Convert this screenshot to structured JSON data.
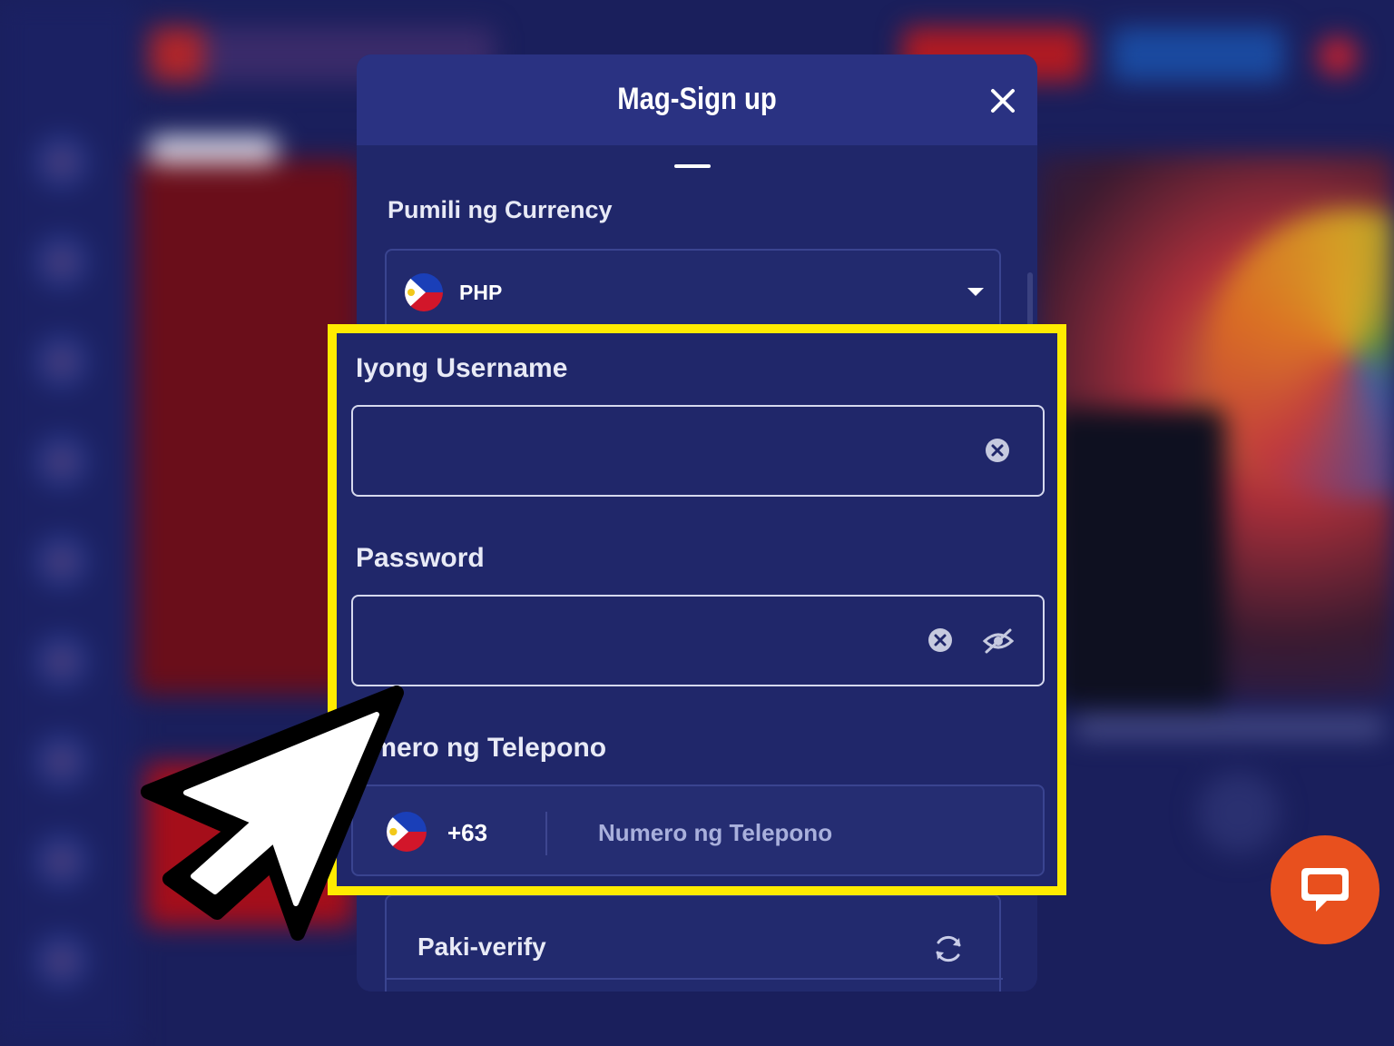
{
  "modal": {
    "title": "Mag-Sign up",
    "currency_label": "Pumili ng Currency",
    "currency_value": "PHP",
    "username_label": "Iyong Username",
    "username_value": "",
    "password_label": "Password",
    "password_value": "",
    "phone_label": "umero ng Telepono",
    "phone_dial_code": "+63",
    "phone_placeholder": "Numero ng Telepono",
    "verify_label": "Paki-verify"
  },
  "icons": {
    "close": "close-icon",
    "caret": "chevron-down-icon",
    "clear": "clear-icon",
    "eye": "eye-off-icon",
    "refresh": "refresh-icon",
    "flag": "philippines-flag-icon",
    "chat": "chat-icon",
    "cursor": "mouse-cursor-icon"
  },
  "colors": {
    "modal_bg": "#20276a",
    "header_bg": "#2a3282",
    "highlight": "#ffeb00",
    "chat_button": "#e8501e"
  }
}
